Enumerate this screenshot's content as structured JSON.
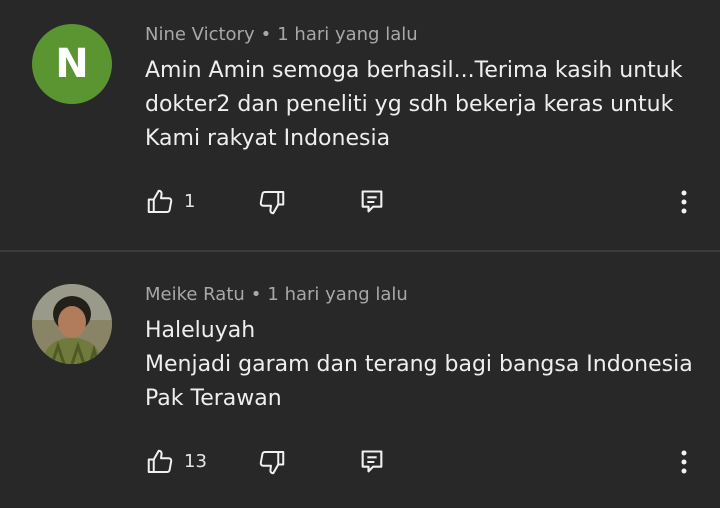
{
  "comments": [
    {
      "avatar_letter": "N",
      "author": "Nine Victory",
      "separator": "•",
      "time": "1 hari yang lalu",
      "lines": [
        "Amin Amin semoga berhasil...Terima kasih untuk",
        "dokter2 dan peneliti yg sdh bekerja keras untuk",
        "Kami rakyat Indonesia"
      ],
      "like_count": "1"
    },
    {
      "author": "Meike Ratu",
      "separator": "•",
      "time": "1 hari yang lalu",
      "lines": [
        "Haleluyah",
        "Menjadi garam dan terang bagi bangsa Indonesia",
        "Pak Terawan"
      ],
      "like_count": "13"
    }
  ],
  "icons": {
    "like": "thumbs-up-icon",
    "dislike": "thumbs-down-icon",
    "reply": "reply-icon",
    "menu": "more-vertical-icon"
  },
  "colors": {
    "background": "#282828",
    "avatar_green": "#5b9531",
    "meta_text": "#a8a8a8",
    "body_text": "#eeeeee"
  }
}
